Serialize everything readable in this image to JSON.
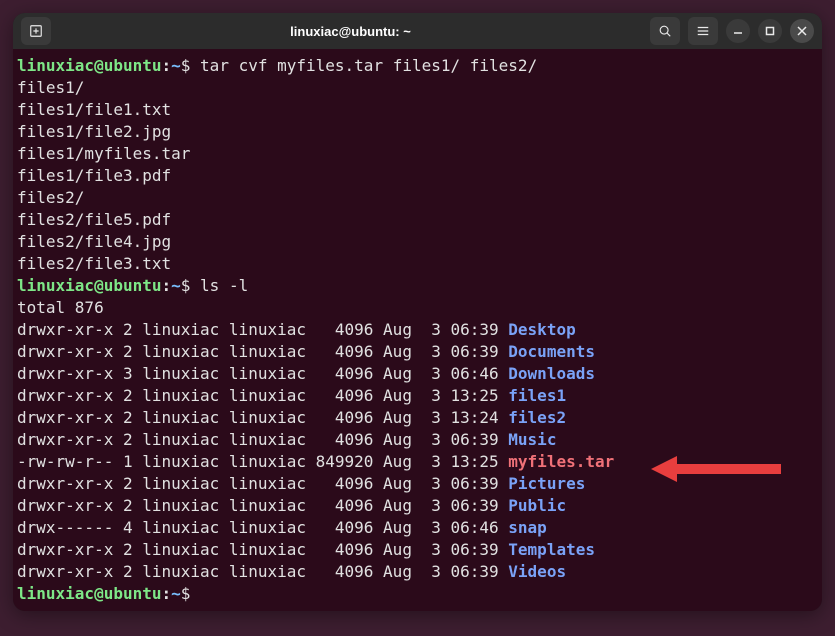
{
  "titlebar": {
    "title": "linuxiac@ubuntu: ~"
  },
  "prompt": {
    "user": "linuxiac",
    "at": "@",
    "host": "ubuntu",
    "colon": ":",
    "path": "~",
    "sign": "$ "
  },
  "cmd1": "tar cvf myfiles.tar files1/ files2/",
  "tar_output": [
    "files1/",
    "files1/file1.txt",
    "files1/file2.jpg",
    "files1/myfiles.tar",
    "files1/file3.pdf",
    "files2/",
    "files2/file5.pdf",
    "files2/file4.jpg",
    "files2/file3.txt"
  ],
  "cmd2": "ls -l",
  "total": "total 876",
  "ls": [
    {
      "perms": "drwxr-xr-x 2 linuxiac linuxiac   4096 Aug  3 06:39 ",
      "name": "Desktop",
      "cls": "dir"
    },
    {
      "perms": "drwxr-xr-x 2 linuxiac linuxiac   4096 Aug  3 06:39 ",
      "name": "Documents",
      "cls": "dir"
    },
    {
      "perms": "drwxr-xr-x 3 linuxiac linuxiac   4096 Aug  3 06:46 ",
      "name": "Downloads",
      "cls": "dir"
    },
    {
      "perms": "drwxr-xr-x 2 linuxiac linuxiac   4096 Aug  3 13:25 ",
      "name": "files1",
      "cls": "dir"
    },
    {
      "perms": "drwxr-xr-x 2 linuxiac linuxiac   4096 Aug  3 13:24 ",
      "name": "files2",
      "cls": "dir"
    },
    {
      "perms": "drwxr-xr-x 2 linuxiac linuxiac   4096 Aug  3 06:39 ",
      "name": "Music",
      "cls": "dir"
    },
    {
      "perms": "-rw-rw-r-- 1 linuxiac linuxiac 849920 Aug  3 13:25 ",
      "name": "myfiles.tar",
      "cls": "tarfile"
    },
    {
      "perms": "drwxr-xr-x 2 linuxiac linuxiac   4096 Aug  3 06:39 ",
      "name": "Pictures",
      "cls": "dir"
    },
    {
      "perms": "drwxr-xr-x 2 linuxiac linuxiac   4096 Aug  3 06:39 ",
      "name": "Public",
      "cls": "dir"
    },
    {
      "perms": "drwx------ 4 linuxiac linuxiac   4096 Aug  3 06:46 ",
      "name": "snap",
      "cls": "dir"
    },
    {
      "perms": "drwxr-xr-x 2 linuxiac linuxiac   4096 Aug  3 06:39 ",
      "name": "Templates",
      "cls": "dir"
    },
    {
      "perms": "drwxr-xr-x 2 linuxiac linuxiac   4096 Aug  3 06:39 ",
      "name": "Videos",
      "cls": "dir"
    }
  ]
}
